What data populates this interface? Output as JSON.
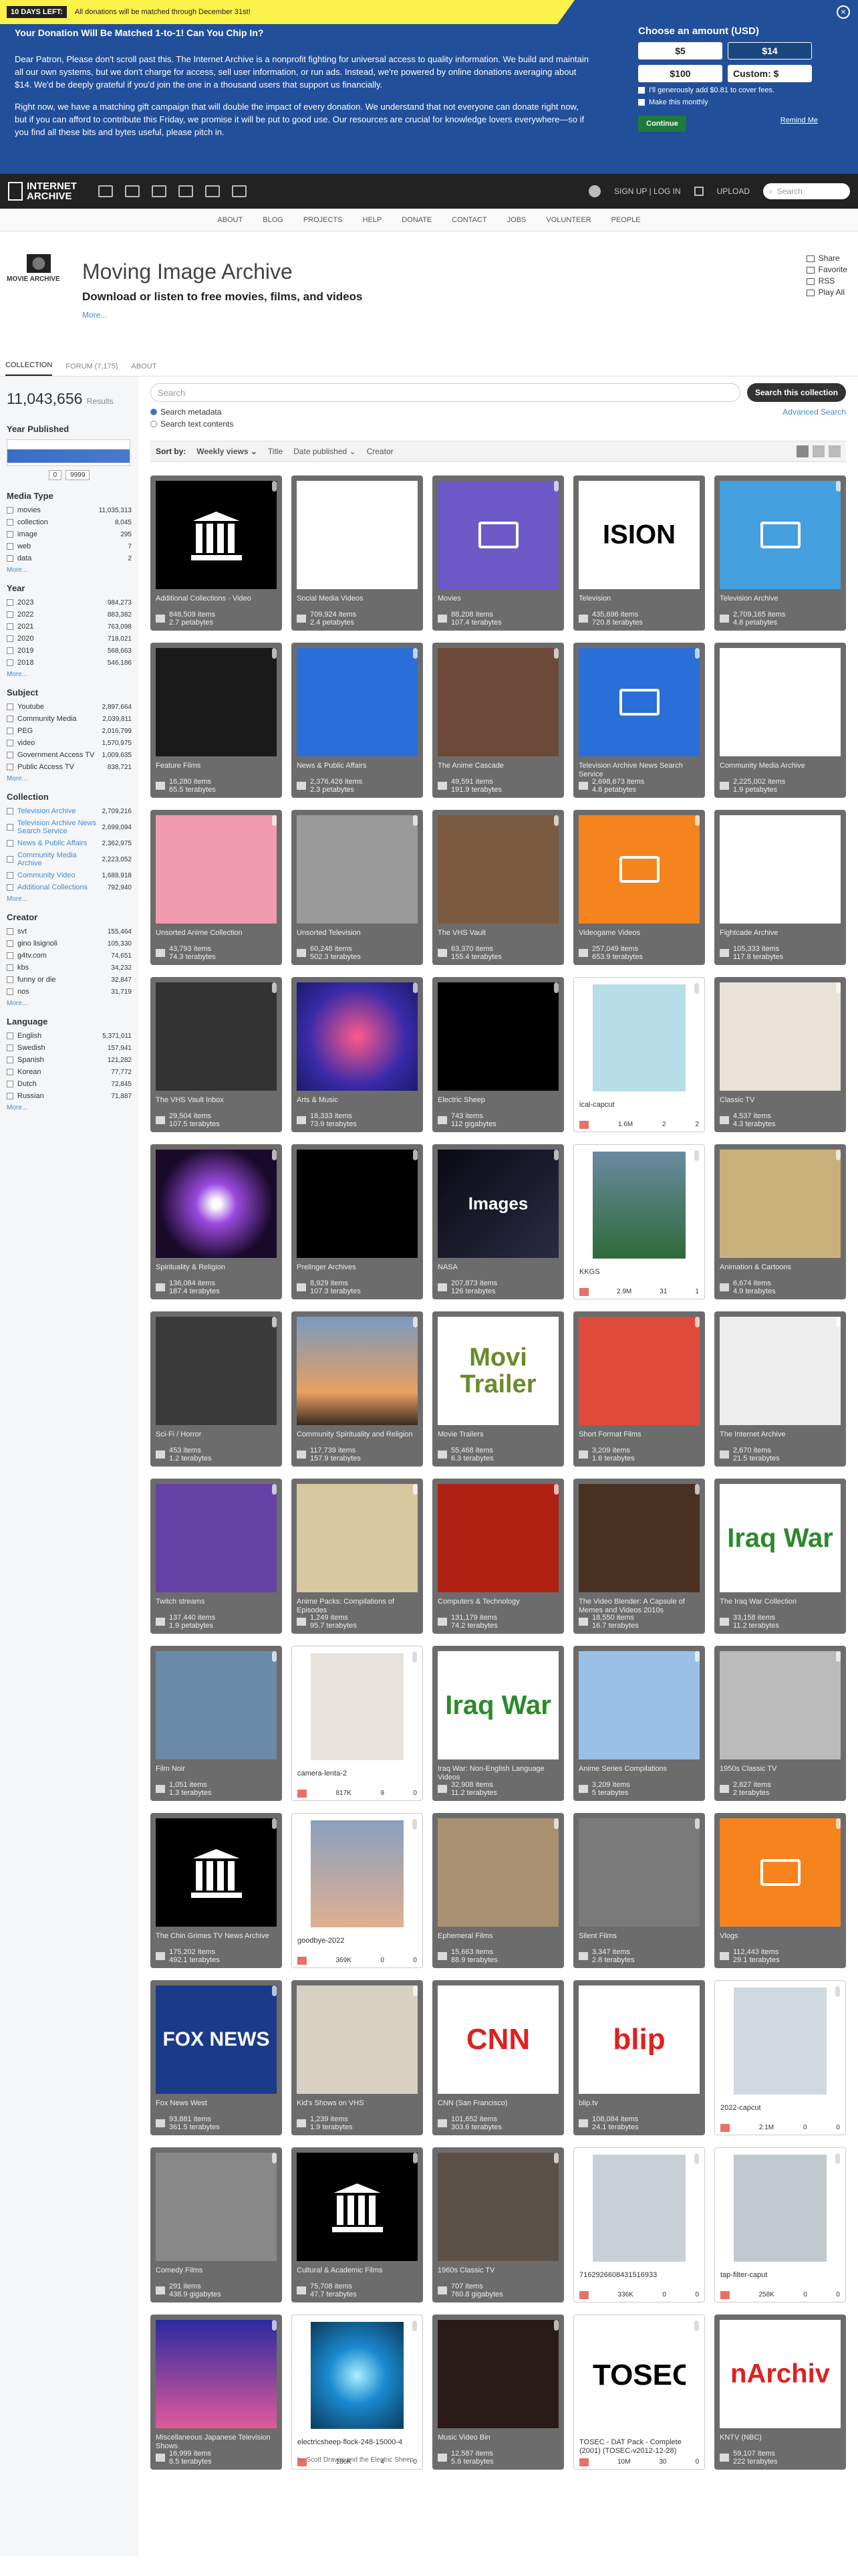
{
  "banner": {
    "days_badge": "10 DAYS LEFT:",
    "days_text": "All donations will be matched through December 31st!",
    "close": "×",
    "heading": "Your Donation Will Be Matched 1-to-1! Can You Chip In?",
    "p1": "Dear Patron, Please don't scroll past this. The Internet Archive is a nonprofit fighting for universal access to quality information. We build and maintain all our own systems, but we don't charge for access, sell user information, or run ads. Instead, we're powered by online donations averaging about $14. We'd be deeply grateful if you'd join the one in a thousand users that support us financially.",
    "p2": "Right now, we have a matching gift campaign that will double the impact of every donation. We understand that not everyone can donate right now, but if you can afford to contribute this Friday, we promise it will be put to good use. Our resources are crucial for knowledge lovers everywhere—so if you find all these bits and bytes useful, please pitch in.",
    "choose": "Choose an amount (USD)",
    "amounts": [
      "$5",
      "$14",
      "$100",
      "Custom: $"
    ],
    "check1": "I'll generously add $0.81 to cover fees.",
    "check2": "Make this monthly",
    "continue": "Continue",
    "remind": "Remind Me"
  },
  "nav": {
    "logo_line1": "INTERNET",
    "logo_line2": "ARCHIVE",
    "signup": "SIGN UP | LOG IN",
    "upload": "UPLOAD",
    "search": "Search"
  },
  "subnav": [
    "ABOUT",
    "BLOG",
    "PROJECTS",
    "HELP",
    "DONATE",
    "CONTACT",
    "JOBS",
    "VOLUNTEER",
    "PEOPLE"
  ],
  "header": {
    "logo_text": "MOVIE ARCHIVE",
    "title": "Moving Image Archive",
    "subtitle": "Download or listen to free movies, films, and videos",
    "more": "More...",
    "actions": [
      "Share",
      "Favorite",
      "RSS",
      "Play All"
    ]
  },
  "tabs": [
    "COLLECTION",
    "FORUM (7,175)",
    "ABOUT"
  ],
  "sidebar": {
    "results_count": "11,043,656",
    "results_label": "Results",
    "year_title": "Year Published",
    "year_from": "0",
    "year_to": "9999",
    "facets": [
      {
        "title": "Media Type",
        "items": [
          [
            "movies",
            "11,035,313"
          ],
          [
            "collection",
            "8,045"
          ],
          [
            "image",
            "295"
          ],
          [
            "web",
            "7"
          ],
          [
            "data",
            "2"
          ]
        ]
      },
      {
        "title": "Year",
        "items": [
          [
            "2023",
            "984,273"
          ],
          [
            "2022",
            "883,382"
          ],
          [
            "2021",
            "763,098"
          ],
          [
            "2020",
            "718,021"
          ],
          [
            "2019",
            "568,663"
          ],
          [
            "2018",
            "546,186"
          ]
        ]
      },
      {
        "title": "Subject",
        "items": [
          [
            "Youtube",
            "2,897,664"
          ],
          [
            "Community Media",
            "2,039,811"
          ],
          [
            "PEG",
            "2,016,799"
          ],
          [
            "video",
            "1,570,975"
          ],
          [
            "Government Access TV",
            "1,009,635"
          ],
          [
            "Public Access TV",
            "838,721"
          ]
        ]
      },
      {
        "title": "Collection",
        "items": [
          [
            "Television Archive",
            "2,709,216"
          ],
          [
            "Television Archive News Search Service",
            "2,699,094"
          ],
          [
            "News & Public Affairs",
            "2,362,975"
          ],
          [
            "Community Media Archive",
            "2,223,052"
          ],
          [
            "Community Video",
            "1,688,918"
          ],
          [
            "Additional Collections",
            "792,940"
          ]
        ]
      },
      {
        "title": "Creator",
        "items": [
          [
            "svt",
            "155,464"
          ],
          [
            "gino lisignoli",
            "105,330"
          ],
          [
            "g4tv.com",
            "74,651"
          ],
          [
            "kbs",
            "34,232"
          ],
          [
            "funny or die",
            "32,847"
          ],
          [
            "nos",
            "31,719"
          ]
        ]
      },
      {
        "title": "Language",
        "items": [
          [
            "English",
            "5,371,011"
          ],
          [
            "Swedish",
            "157,941"
          ],
          [
            "Spanish",
            "121,282"
          ],
          [
            "Korean",
            "77,772"
          ],
          [
            "Dutch",
            "72,845"
          ],
          [
            "Russian",
            "71,887"
          ]
        ]
      }
    ],
    "more": "More..."
  },
  "search": {
    "placeholder": "Search",
    "button": "Search this collection",
    "opt1": "Search metadata",
    "opt2": "Search text contents",
    "advanced": "Advanced Search"
  },
  "sort": {
    "label": "Sort by:",
    "options": [
      "Weekly views ⌄",
      "Title",
      "Date published ⌄",
      "Creator"
    ]
  },
  "tiles": [
    {
      "t": "c",
      "title": "Additional Collections - Video",
      "items": "848,509 items",
      "size": "2.7 petabytes",
      "thumb": "pillar"
    },
    {
      "t": "c",
      "title": "Social Media Videos",
      "items": "709,924 items",
      "size": "2.4 petabytes",
      "thumb": "social"
    },
    {
      "t": "c",
      "title": "Movies",
      "items": "88,208 items",
      "size": "107.4 terabytes",
      "thumb": "movies"
    },
    {
      "t": "c",
      "title": "Television",
      "items": "435,696 items",
      "size": "720.8 terabytes",
      "thumb": "text",
      "txt": "ISION"
    },
    {
      "t": "c",
      "title": "Television Archive",
      "items": "2,709,165 items",
      "size": "4.8 petabytes",
      "thumb": "tv"
    },
    {
      "t": "c",
      "title": "Feature Films",
      "items": "16,280 items",
      "size": "65.5 terabytes",
      "thumb": "dark"
    },
    {
      "t": "c",
      "title": "News & Public Affairs",
      "items": "2,376,426 items",
      "size": "2.3 petabytes",
      "thumb": "news"
    },
    {
      "t": "c",
      "title": "The Anime Cascade",
      "items": "49,591 items",
      "size": "191.9 terabytes",
      "thumb": "anime"
    },
    {
      "t": "c",
      "title": "Television Archive News Search Service",
      "items": "2,698,673 items",
      "size": "4.8 petabytes",
      "thumb": "tvnews"
    },
    {
      "t": "c",
      "title": "Community Media Archive",
      "items": "2,225,002 items",
      "size": "1.9 petabytes",
      "thumb": "community"
    },
    {
      "t": "c",
      "title": "Unsorted Anime Collection",
      "items": "43,793 items",
      "size": "74.3 terabytes",
      "thumb": "pinkanime"
    },
    {
      "t": "c",
      "title": "Unsorted Television",
      "items": "60,248 items",
      "size": "502.3 terabytes",
      "thumb": "bw"
    },
    {
      "t": "c",
      "title": "The VHS Vault",
      "items": "63,370 items",
      "size": "155.4 terabytes",
      "thumb": "vhs"
    },
    {
      "t": "c",
      "title": "Videogame Videos",
      "items": "257,049 items",
      "size": "653.9 terabytes",
      "thumb": "game"
    },
    {
      "t": "c",
      "title": "Fightcade Archive",
      "items": "105,333 items",
      "size": "117.8 terabytes",
      "thumb": "arcade"
    },
    {
      "t": "c",
      "title": "The VHS Vault Inbox",
      "items": "29,504 items",
      "size": "107.5 terabytes",
      "thumb": "tvs"
    },
    {
      "t": "c",
      "title": "Arts & Music",
      "items": "18,333 items",
      "size": "73.9 terabytes",
      "thumb": "arts"
    },
    {
      "t": "c",
      "title": "Electric Sheep",
      "items": "743 items",
      "size": "112 gigabytes",
      "thumb": "sheep"
    },
    {
      "t": "i",
      "title": "ical-capcut",
      "views": "1.6M",
      "favs": "2",
      "reviews": "2",
      "thumb": "beach"
    },
    {
      "t": "c",
      "title": "Classic TV",
      "items": "4,537 items",
      "size": "4.3 terabytes",
      "thumb": "oldtv"
    },
    {
      "t": "c",
      "title": "Spirituality & Religion",
      "items": "136,084 items",
      "size": "187.4 terabytes",
      "thumb": "spirit"
    },
    {
      "t": "c",
      "title": "Prelinger Archives",
      "items": "8,929 items",
      "size": "107.3 terabytes",
      "thumb": "hand"
    },
    {
      "t": "c",
      "title": "NASA",
      "items": "207,873 items",
      "size": "126 terabytes",
      "thumb": "nasa",
      "txt": "Images"
    },
    {
      "t": "i",
      "title": "KKGS",
      "views": "2.9M",
      "favs": "31",
      "reviews": "1",
      "thumb": "garden"
    },
    {
      "t": "c",
      "title": "Animation & Cartoons",
      "items": "6,674 items",
      "size": "4.9 terabytes",
      "thumb": "cartoon"
    },
    {
      "t": "c",
      "title": "Sci-Fi / Horror",
      "items": "453 items",
      "size": "1.2 terabytes",
      "thumb": "horror"
    },
    {
      "t": "c",
      "title": "Community Spirituality and Religion",
      "items": "117,739 items",
      "size": "157.9 terabytes",
      "thumb": "sunset"
    },
    {
      "t": "c",
      "title": "Movie Trailers",
      "items": "55,468 items",
      "size": "6.3 terabytes",
      "thumb": "trailer",
      "txt": "Movi Trailer"
    },
    {
      "t": "c",
      "title": "Short Format Films",
      "items": "3,209 items",
      "size": "1.6 terabytes",
      "thumb": "filmstrip"
    },
    {
      "t": "c",
      "title": "The Internet Archive",
      "items": "2,670 items",
      "size": "21.5 terabytes",
      "thumb": "building"
    },
    {
      "t": "c",
      "title": "Twitch streams",
      "items": "137,440 items",
      "size": "1.9 petabytes",
      "thumb": "twitch"
    },
    {
      "t": "c",
      "title": "Anime Packs: Compilations of Episodes",
      "items": "1,249 items",
      "size": "95.7 terabytes",
      "thumb": "animepack"
    },
    {
      "t": "c",
      "title": "Computers & Technology",
      "items": "131,179 items",
      "size": "74.2 terabytes",
      "thumb": "circuit"
    },
    {
      "t": "c",
      "title": "The Video Blender: A Capsule of Memes and Videos 2010s",
      "items": "18,550 items",
      "size": "16.7 terabytes",
      "thumb": "blender"
    },
    {
      "t": "c",
      "title": "The Iraq War Collection",
      "items": "33,158 items",
      "size": "11.2 terabytes",
      "thumb": "iraq",
      "txt": "Iraq War"
    },
    {
      "t": "c",
      "title": "Film Noir",
      "items": "1,051 items",
      "size": "1.3 terabytes",
      "thumb": "hat"
    },
    {
      "t": "i",
      "title": "camera-lenta-2",
      "views": "817K",
      "favs": "9",
      "reviews": "0",
      "thumb": "person"
    },
    {
      "t": "c",
      "title": "Iraq War: Non-English Language Videos",
      "items": "32,908 items",
      "size": "11.2 terabytes",
      "thumb": "iraq",
      "txt": "Iraq War"
    },
    {
      "t": "c",
      "title": "Anime Series Compilations",
      "items": "3,209 items",
      "size": "5 terabytes",
      "thumb": "animeseries"
    },
    {
      "t": "c",
      "title": "1950s Classic TV",
      "items": "2,827 items",
      "size": "2 terabytes",
      "thumb": "bwface"
    },
    {
      "t": "c",
      "title": "The Chin Grimes TV News Archive",
      "items": "175,202 items",
      "size": "492.1 terabytes",
      "thumb": "pillar"
    },
    {
      "t": "i",
      "title": "goodbye-2022",
      "views": "369K",
      "favs": "0",
      "reviews": "0",
      "thumb": "dusk"
    },
    {
      "t": "c",
      "title": "Ephemeral Films",
      "items": "15,663 items",
      "size": "88.9 terabytes",
      "thumb": "ephemeral"
    },
    {
      "t": "c",
      "title": "Silent Films",
      "items": "3,347 items",
      "size": "2.8 terabytes",
      "thumb": "silent"
    },
    {
      "t": "c",
      "title": "Vlogs",
      "items": "112,443 items",
      "size": "29.1 terabytes",
      "thumb": "vlog"
    },
    {
      "t": "c",
      "title": "Fox News West",
      "items": "93,881 items",
      "size": "361.5 terabytes",
      "thumb": "fox",
      "txt": "FOX NEWS"
    },
    {
      "t": "c",
      "title": "Kid's Shows on VHS",
      "items": "1,239 items",
      "size": "1.9 terabytes",
      "thumb": "kidsvhs"
    },
    {
      "t": "c",
      "title": "CNN (San Francisco)",
      "items": "101,652 items",
      "size": "303.6 terabytes",
      "thumb": "cnn",
      "txt": "CNN"
    },
    {
      "t": "c",
      "title": "blip.tv",
      "items": "108,084 items",
      "size": "24.1 terabytes",
      "thumb": "blip",
      "txt": "blip"
    },
    {
      "t": "i",
      "title": "2022-capcut",
      "views": "2.1M",
      "favs": "0",
      "reviews": "0",
      "thumb": "street"
    },
    {
      "t": "c",
      "title": "Comedy Films",
      "items": "291 items",
      "size": "438.9 gigabytes",
      "thumb": "chaplin"
    },
    {
      "t": "c",
      "title": "Cultural & Academic Films",
      "items": "75,708 items",
      "size": "47.7 terabytes",
      "thumb": "pillar"
    },
    {
      "t": "c",
      "title": "1960s Classic TV",
      "items": "707 items",
      "size": "760.8 gigabytes",
      "thumb": "man"
    },
    {
      "t": "i",
      "title": "7162926608431516933",
      "views": "336K",
      "favs": "0",
      "reviews": "0",
      "thumb": "person2"
    },
    {
      "t": "i",
      "title": "tap-filter-caput",
      "views": "258K",
      "favs": "0",
      "reviews": "0",
      "thumb": "person3"
    },
    {
      "t": "c",
      "title": "Miscellaneous Japanese Television Shows",
      "items": "16,999 items",
      "size": "8.5 terabytes",
      "thumb": "japan"
    },
    {
      "t": "i",
      "title": "electricsheep-flock-248-15000-4",
      "sub": "by Scott Draves and the Electric Sheep",
      "views": "186K",
      "favs": "4",
      "reviews": "0",
      "thumb": "fractal"
    },
    {
      "t": "c",
      "title": "Music Video Bin",
      "items": "12,587 items",
      "size": "5.6 terabytes",
      "thumb": "musicvid"
    },
    {
      "t": "i",
      "title": "TOSEC - DAT Pack - Complete (2001) (TOSEC-v2012-12-28)",
      "views": "10M",
      "favs": "30",
      "reviews": "0",
      "thumb": "tosec",
      "txt": "TOSEC"
    },
    {
      "t": "c",
      "title": "KNTV (NBC)",
      "items": "59,107 items",
      "size": "222 terabytes",
      "thumb": "knarchiv",
      "txt": "nArchiv"
    }
  ]
}
